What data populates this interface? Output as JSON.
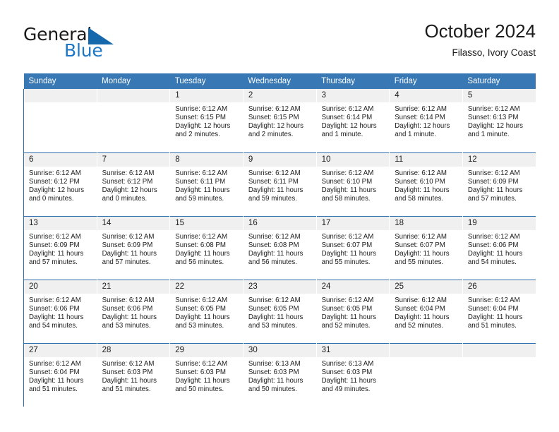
{
  "brand": {
    "name_part1": "General",
    "name_part2": "Blue",
    "flag_icon": "triangle-flag-icon",
    "accent_color": "#1668ad"
  },
  "header": {
    "title": "October 2024",
    "subtitle": "Filasso, Ivory Coast"
  },
  "theme": {
    "header_blue": "#3878b4",
    "grid_blue": "#2f6fad",
    "daynum_gray": "#f0f0f0"
  },
  "weekdays": [
    "Sunday",
    "Monday",
    "Tuesday",
    "Wednesday",
    "Thursday",
    "Friday",
    "Saturday"
  ],
  "weeks": [
    [
      {
        "day": "",
        "blank": true
      },
      {
        "day": "",
        "blank": true
      },
      {
        "day": "1",
        "sunrise": "Sunrise: 6:12 AM",
        "sunset": "Sunset: 6:15 PM",
        "daylight": "Daylight: 12 hours and 2 minutes."
      },
      {
        "day": "2",
        "sunrise": "Sunrise: 6:12 AM",
        "sunset": "Sunset: 6:15 PM",
        "daylight": "Daylight: 12 hours and 2 minutes."
      },
      {
        "day": "3",
        "sunrise": "Sunrise: 6:12 AM",
        "sunset": "Sunset: 6:14 PM",
        "daylight": "Daylight: 12 hours and 1 minute."
      },
      {
        "day": "4",
        "sunrise": "Sunrise: 6:12 AM",
        "sunset": "Sunset: 6:14 PM",
        "daylight": "Daylight: 12 hours and 1 minute."
      },
      {
        "day": "5",
        "sunrise": "Sunrise: 6:12 AM",
        "sunset": "Sunset: 6:13 PM",
        "daylight": "Daylight: 12 hours and 1 minute."
      }
    ],
    [
      {
        "day": "6",
        "sunrise": "Sunrise: 6:12 AM",
        "sunset": "Sunset: 6:12 PM",
        "daylight": "Daylight: 12 hours and 0 minutes."
      },
      {
        "day": "7",
        "sunrise": "Sunrise: 6:12 AM",
        "sunset": "Sunset: 6:12 PM",
        "daylight": "Daylight: 12 hours and 0 minutes."
      },
      {
        "day": "8",
        "sunrise": "Sunrise: 6:12 AM",
        "sunset": "Sunset: 6:11 PM",
        "daylight": "Daylight: 11 hours and 59 minutes."
      },
      {
        "day": "9",
        "sunrise": "Sunrise: 6:12 AM",
        "sunset": "Sunset: 6:11 PM",
        "daylight": "Daylight: 11 hours and 59 minutes."
      },
      {
        "day": "10",
        "sunrise": "Sunrise: 6:12 AM",
        "sunset": "Sunset: 6:10 PM",
        "daylight": "Daylight: 11 hours and 58 minutes."
      },
      {
        "day": "11",
        "sunrise": "Sunrise: 6:12 AM",
        "sunset": "Sunset: 6:10 PM",
        "daylight": "Daylight: 11 hours and 58 minutes."
      },
      {
        "day": "12",
        "sunrise": "Sunrise: 6:12 AM",
        "sunset": "Sunset: 6:09 PM",
        "daylight": "Daylight: 11 hours and 57 minutes."
      }
    ],
    [
      {
        "day": "13",
        "sunrise": "Sunrise: 6:12 AM",
        "sunset": "Sunset: 6:09 PM",
        "daylight": "Daylight: 11 hours and 57 minutes."
      },
      {
        "day": "14",
        "sunrise": "Sunrise: 6:12 AM",
        "sunset": "Sunset: 6:09 PM",
        "daylight": "Daylight: 11 hours and 57 minutes."
      },
      {
        "day": "15",
        "sunrise": "Sunrise: 6:12 AM",
        "sunset": "Sunset: 6:08 PM",
        "daylight": "Daylight: 11 hours and 56 minutes."
      },
      {
        "day": "16",
        "sunrise": "Sunrise: 6:12 AM",
        "sunset": "Sunset: 6:08 PM",
        "daylight": "Daylight: 11 hours and 56 minutes."
      },
      {
        "day": "17",
        "sunrise": "Sunrise: 6:12 AM",
        "sunset": "Sunset: 6:07 PM",
        "daylight": "Daylight: 11 hours and 55 minutes."
      },
      {
        "day": "18",
        "sunrise": "Sunrise: 6:12 AM",
        "sunset": "Sunset: 6:07 PM",
        "daylight": "Daylight: 11 hours and 55 minutes."
      },
      {
        "day": "19",
        "sunrise": "Sunrise: 6:12 AM",
        "sunset": "Sunset: 6:06 PM",
        "daylight": "Daylight: 11 hours and 54 minutes."
      }
    ],
    [
      {
        "day": "20",
        "sunrise": "Sunrise: 6:12 AM",
        "sunset": "Sunset: 6:06 PM",
        "daylight": "Daylight: 11 hours and 54 minutes."
      },
      {
        "day": "21",
        "sunrise": "Sunrise: 6:12 AM",
        "sunset": "Sunset: 6:06 PM",
        "daylight": "Daylight: 11 hours and 53 minutes."
      },
      {
        "day": "22",
        "sunrise": "Sunrise: 6:12 AM",
        "sunset": "Sunset: 6:05 PM",
        "daylight": "Daylight: 11 hours and 53 minutes."
      },
      {
        "day": "23",
        "sunrise": "Sunrise: 6:12 AM",
        "sunset": "Sunset: 6:05 PM",
        "daylight": "Daylight: 11 hours and 53 minutes."
      },
      {
        "day": "24",
        "sunrise": "Sunrise: 6:12 AM",
        "sunset": "Sunset: 6:05 PM",
        "daylight": "Daylight: 11 hours and 52 minutes."
      },
      {
        "day": "25",
        "sunrise": "Sunrise: 6:12 AM",
        "sunset": "Sunset: 6:04 PM",
        "daylight": "Daylight: 11 hours and 52 minutes."
      },
      {
        "day": "26",
        "sunrise": "Sunrise: 6:12 AM",
        "sunset": "Sunset: 6:04 PM",
        "daylight": "Daylight: 11 hours and 51 minutes."
      }
    ],
    [
      {
        "day": "27",
        "sunrise": "Sunrise: 6:12 AM",
        "sunset": "Sunset: 6:04 PM",
        "daylight": "Daylight: 11 hours and 51 minutes."
      },
      {
        "day": "28",
        "sunrise": "Sunrise: 6:12 AM",
        "sunset": "Sunset: 6:03 PM",
        "daylight": "Daylight: 11 hours and 51 minutes."
      },
      {
        "day": "29",
        "sunrise": "Sunrise: 6:12 AM",
        "sunset": "Sunset: 6:03 PM",
        "daylight": "Daylight: 11 hours and 50 minutes."
      },
      {
        "day": "30",
        "sunrise": "Sunrise: 6:13 AM",
        "sunset": "Sunset: 6:03 PM",
        "daylight": "Daylight: 11 hours and 50 minutes."
      },
      {
        "day": "31",
        "sunrise": "Sunrise: 6:13 AM",
        "sunset": "Sunset: 6:03 PM",
        "daylight": "Daylight: 11 hours and 49 minutes."
      },
      {
        "day": "",
        "blank": true
      },
      {
        "day": "",
        "blank": true
      }
    ]
  ]
}
